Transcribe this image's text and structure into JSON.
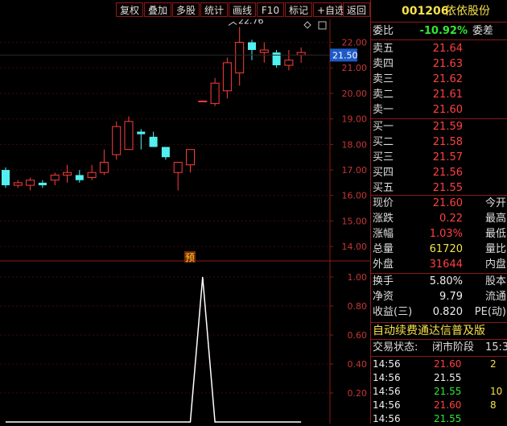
{
  "toolbar": {
    "buttons": [
      "复权",
      "叠加",
      "多股",
      "统计",
      "画线",
      "F10",
      "标记",
      "+自选",
      "返回"
    ]
  },
  "chart": {
    "price_axis": [
      "22.00",
      "21.00",
      "20.00",
      "19.00",
      "18.00",
      "17.00",
      "16.00",
      "15.00",
      "14.00"
    ],
    "current_price_tag": "21.50",
    "high_annotation": "22.76",
    "indicator_axis": [
      "1.00",
      "0.80",
      "0.60",
      "0.40",
      "0.20"
    ],
    "marker_label": "预",
    "diamond_icon": "diamond-icon",
    "colors": {
      "up": "#ff3c3c",
      "down": "#52f0f0",
      "axis": "#8a1a1a",
      "text_red": "#c73535"
    }
  },
  "chart_data": [
    {
      "type": "candlestick",
      "title": "",
      "ylim": [
        13.5,
        22.9
      ],
      "candles": [
        {
          "o": 17.0,
          "c": 16.4,
          "h": 17.1,
          "l": 16.3
        },
        {
          "o": 16.4,
          "c": 16.5,
          "h": 16.6,
          "l": 16.3
        },
        {
          "o": 16.4,
          "c": 16.6,
          "h": 16.7,
          "l": 16.2
        },
        {
          "o": 16.5,
          "c": 16.4,
          "h": 16.6,
          "l": 16.3
        },
        {
          "o": 16.6,
          "c": 16.8,
          "h": 16.9,
          "l": 16.4
        },
        {
          "o": 16.8,
          "c": 16.9,
          "h": 17.2,
          "l": 16.5
        },
        {
          "o": 16.8,
          "c": 16.6,
          "h": 17.0,
          "l": 16.5
        },
        {
          "o": 16.7,
          "c": 16.9,
          "h": 17.2,
          "l": 16.6
        },
        {
          "o": 16.9,
          "c": 17.3,
          "h": 17.8,
          "l": 16.8
        },
        {
          "o": 17.6,
          "c": 18.7,
          "h": 18.9,
          "l": 17.4
        },
        {
          "o": 17.8,
          "c": 18.9,
          "h": 19.1,
          "l": 17.8
        },
        {
          "o": 18.5,
          "c": 18.4,
          "h": 18.6,
          "l": 17.8
        },
        {
          "o": 18.3,
          "c": 17.9,
          "h": 18.5,
          "l": 17.9
        },
        {
          "o": 17.9,
          "c": 17.5,
          "h": 17.9,
          "l": 17.4
        },
        {
          "o": 16.9,
          "c": 17.3,
          "h": 17.3,
          "l": 16.2
        },
        {
          "o": 17.2,
          "c": 17.8,
          "h": 17.8,
          "l": 16.9
        },
        {
          "o": 19.7,
          "c": 19.7,
          "h": 19.7,
          "l": 19.7
        },
        {
          "o": 19.6,
          "c": 20.4,
          "h": 20.6,
          "l": 19.5
        },
        {
          "o": 20.1,
          "c": 21.2,
          "h": 21.4,
          "l": 19.8
        },
        {
          "o": 20.8,
          "c": 22.0,
          "h": 22.6,
          "l": 20.3
        },
        {
          "o": 22.0,
          "c": 21.7,
          "h": 22.1,
          "l": 21.3
        },
        {
          "o": 21.6,
          "c": 21.7,
          "h": 22.0,
          "l": 21.2
        },
        {
          "o": 21.6,
          "c": 21.1,
          "h": 21.7,
          "l": 21.0
        },
        {
          "o": 21.1,
          "c": 21.3,
          "h": 21.7,
          "l": 20.9
        },
        {
          "o": 21.5,
          "c": 21.6,
          "h": 21.8,
          "l": 21.2
        }
      ]
    },
    {
      "type": "line",
      "title": "",
      "ylim": [
        0,
        1.1
      ],
      "x": [
        0,
        1,
        2,
        3,
        4,
        5,
        6,
        7,
        8,
        9,
        10,
        11,
        12,
        13,
        14,
        15,
        16,
        17,
        18,
        19,
        20,
        21,
        22,
        23,
        24
      ],
      "values": [
        0,
        0,
        0,
        0,
        0,
        0,
        0,
        0,
        0,
        0,
        0,
        0,
        0,
        0,
        0,
        0,
        1.0,
        0,
        0,
        0,
        0,
        0,
        0,
        0,
        0
      ]
    }
  ],
  "quote": {
    "code": "001206",
    "name": "依依股份",
    "weibi_label": "委比",
    "weibi_value": "-10.92%",
    "weicha_label": "委差",
    "asks": [
      {
        "label": "卖五",
        "price": "21.64"
      },
      {
        "label": "卖四",
        "price": "21.63"
      },
      {
        "label": "卖三",
        "price": "21.62"
      },
      {
        "label": "卖二",
        "price": "21.61"
      },
      {
        "label": "卖一",
        "price": "21.60"
      }
    ],
    "bids": [
      {
        "label": "买一",
        "price": "21.59"
      },
      {
        "label": "买二",
        "price": "21.58"
      },
      {
        "label": "买三",
        "price": "21.57"
      },
      {
        "label": "买四",
        "price": "21.56"
      },
      {
        "label": "买五",
        "price": "21.55"
      }
    ],
    "stats": [
      {
        "label": "现价",
        "value": "21.60",
        "label2": "今开",
        "color": "red"
      },
      {
        "label": "涨跌",
        "value": "0.22",
        "label2": "最高",
        "color": "red"
      },
      {
        "label": "涨幅",
        "value": "1.03%",
        "label2": "最低",
        "color": "red"
      },
      {
        "label": "总量",
        "value": "61720",
        "label2": "量比",
        "color": "yellow"
      },
      {
        "label": "外盘",
        "value": "31644",
        "label2": "内盘",
        "color": "red"
      }
    ],
    "fundamentals": [
      {
        "label": "换手",
        "value": "5.80%",
        "label2": "股本"
      },
      {
        "label": "净资",
        "value": "9.79",
        "label2": "流通"
      },
      {
        "label": "收益(三)",
        "value": "0.820",
        "label2": "PE(动)"
      }
    ],
    "banner": "自动续费通达信普及版",
    "status_label": "交易状态:",
    "status_value": "闭市阶段",
    "status_time": "15:3",
    "ticks": [
      {
        "time": "14:56",
        "price": "21.60",
        "vol": "2",
        "color": "red"
      },
      {
        "time": "14:56",
        "price": "21.55",
        "vol": "",
        "color": "white"
      },
      {
        "time": "14:56",
        "price": "21.55",
        "vol": "10",
        "color": "green"
      },
      {
        "time": "14:56",
        "price": "21.60",
        "vol": "8",
        "color": "red"
      },
      {
        "time": "14:56",
        "price": "21.55",
        "vol": "",
        "color": "green"
      }
    ]
  }
}
